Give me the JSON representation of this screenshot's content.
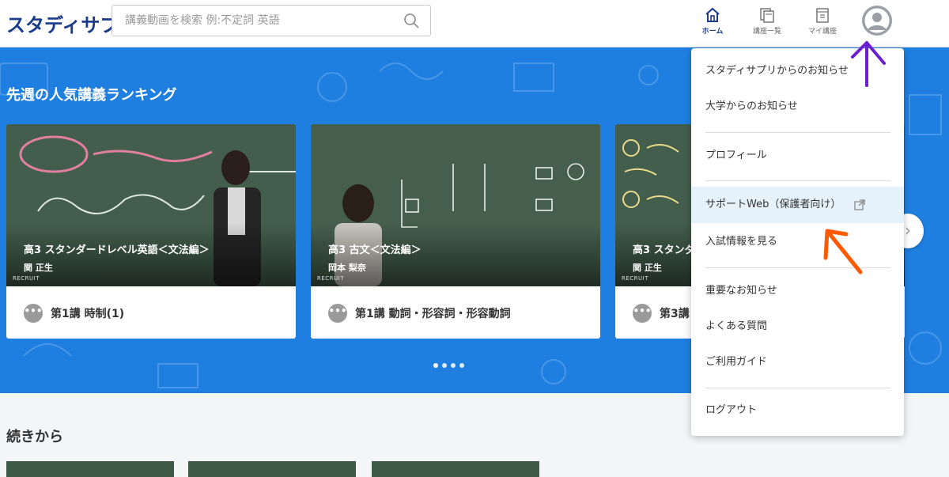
{
  "header": {
    "logo": "スタディサプリ",
    "search": {
      "placeholder": "講義動画を検索 例:不定詞 英語",
      "value": ""
    },
    "nav": [
      {
        "label": "ホーム",
        "icon": "home-icon",
        "active": true
      },
      {
        "label": "講座一覧",
        "icon": "course-list-icon",
        "active": false
      },
      {
        "label": "マイ講座",
        "icon": "my-course-icon",
        "active": false
      }
    ]
  },
  "hero": {
    "section_title": "先週の人気講義ランキング",
    "cards": [
      {
        "course_title": "高3 スタンダードレベル英語＜文法編＞",
        "teacher": "関 正生",
        "lesson": "第1講 時制(1)"
      },
      {
        "course_title": "高3 古文＜文法編＞",
        "teacher": "岡本 梨奈",
        "lesson": "第1講 動詞・形容詞・形容動詞"
      },
      {
        "course_title": "高3 スタンダ",
        "teacher": "関 正生",
        "lesson": "第3講"
      }
    ],
    "more_label": "•••",
    "next_label": "›",
    "brand_mark": "RECRUIT",
    "carousel_dots": 4
  },
  "continue": {
    "title": "続きから"
  },
  "dropdown": {
    "items": [
      {
        "label": "スタディサプリからのお知らせ"
      },
      {
        "label": "大学からのお知らせ"
      },
      {
        "label": "プロフィール"
      },
      {
        "label": "サポートWeb（保護者向け）",
        "external": true,
        "highlighted": true
      },
      {
        "label": "入試情報を見る"
      },
      {
        "label": "重要なお知らせ"
      },
      {
        "label": "よくある質問"
      },
      {
        "label": "ご利用ガイド"
      },
      {
        "label": "ログアウト"
      }
    ]
  },
  "colors": {
    "brand": "#1a3a8c",
    "hero_bg": "#1f7fe0",
    "highlight": "#e6f2fb",
    "annotation_purple": "#6a1fd1",
    "annotation_orange": "#ff5a00"
  }
}
